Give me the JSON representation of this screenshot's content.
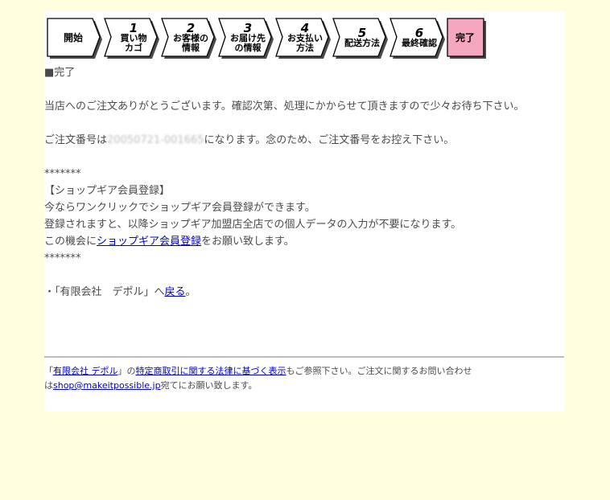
{
  "steps": [
    {
      "num": "",
      "line1": "開始",
      "line2": ""
    },
    {
      "num": "1",
      "line1": "買い物",
      "line2": "カゴ"
    },
    {
      "num": "2",
      "line1": "お客様の",
      "line2": "情報"
    },
    {
      "num": "3",
      "line1": "お届け先",
      "line2": "の情報"
    },
    {
      "num": "4",
      "line1": "お支払い",
      "line2": "方法"
    },
    {
      "num": "5",
      "line1": "配送方法",
      "line2": ""
    },
    {
      "num": "6",
      "line1": "最終確認",
      "line2": ""
    },
    {
      "num": "",
      "line1": "完了",
      "line2": ""
    }
  ],
  "colors": {
    "step_fill": "#ffffff",
    "step_active_fill": "#f4a7bf",
    "shadow": "#4a4a4a",
    "background": "#fffedf",
    "link": "#0000cc"
  },
  "main": {
    "heading": "■完了",
    "thanks": "当店へのご注文ありがとうございます。確認次第、処理にかからせて頂きますので少々お待ち下さい。",
    "order_prefix": "ご注文番号は",
    "order_number": "20050721-001665",
    "order_suffix": "になります。念のため、ご注文番号をお控え下さい。",
    "stars": "*******",
    "member_title": "【ショップギア会員登録】",
    "member_line1": "今ならワンクリックでショップギア会員登録ができます。",
    "member_line2": "登録されますと、以降ショップギア加盟店全店での個人データの入力が不要になります。",
    "member_line3_prefix": "この機会に",
    "member_link": "ショップギア会員登録",
    "member_line3_suffix": "をお願い致します。",
    "stars2": "*******",
    "back_prefix": "・「有限会社　デポル」へ",
    "back_link": "戻る",
    "back_suffix": "。"
  },
  "footer": {
    "open_quote": "「",
    "company_link": "有限会社 デポル",
    "mid": "」の",
    "law_link": "特定商取引に関する法律に基づく表示",
    "text_after_law": "もご参照下さい。ご注文に関するお問い合わせ",
    "text_line2_prefix": "は",
    "email_link": "shop@makeitpossible.jp",
    "text_line2_suffix": "宛てにお願い致します。"
  }
}
